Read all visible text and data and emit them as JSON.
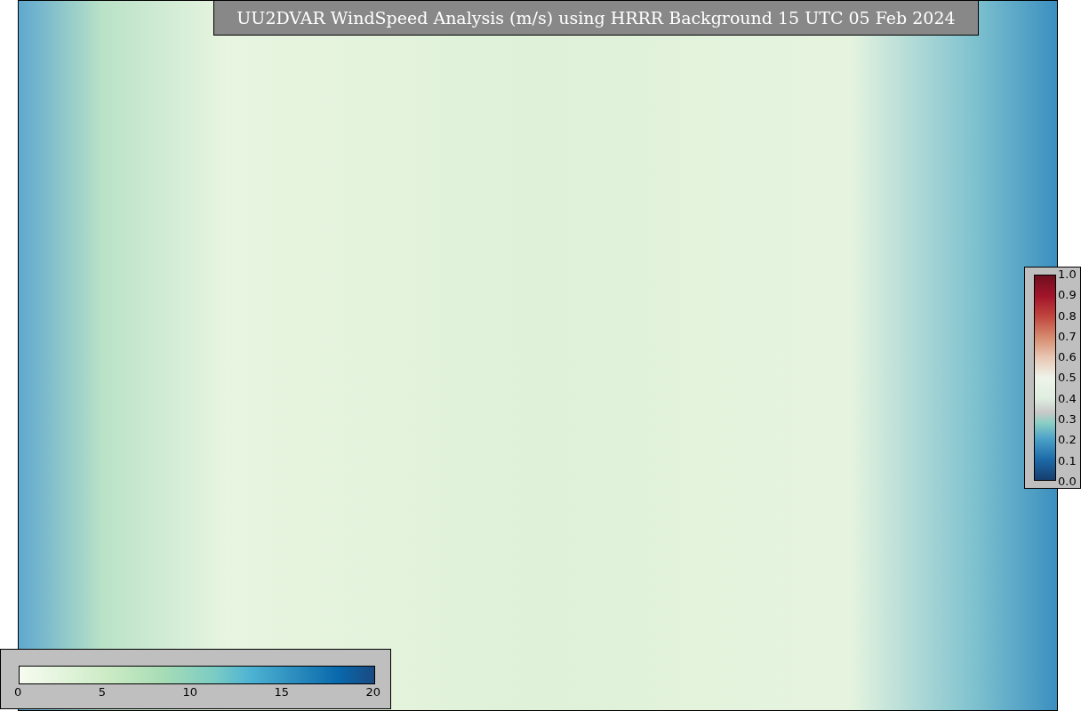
{
  "title": "UU2DVAR WindSpeed Analysis (m/s) using HRRR Background 15 UTC 05 Feb 2024",
  "speed_colorbar": {
    "ticks": [
      "0",
      "5",
      "10",
      "15",
      "20"
    ]
  },
  "ratio_colorbar": {
    "ticks": [
      "1.0",
      "0.9",
      "0.8",
      "0.7",
      "0.6",
      "0.5",
      "0.4",
      "0.3",
      "0.2",
      "0.1",
      "0.0"
    ]
  }
}
